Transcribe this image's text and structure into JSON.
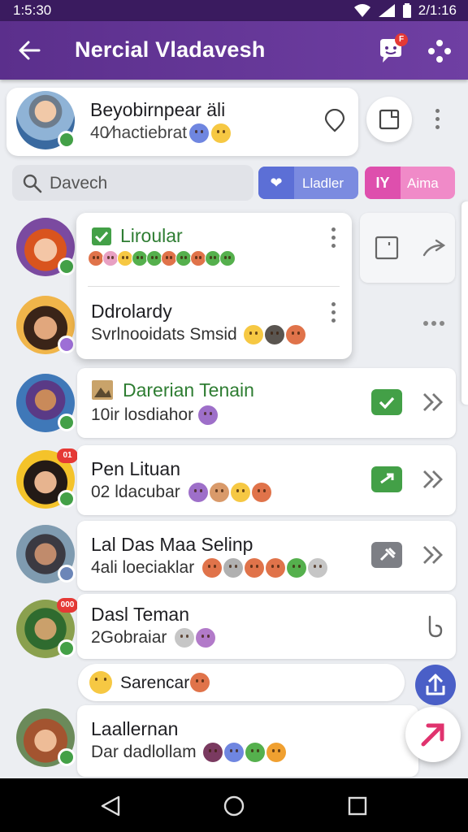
{
  "status_bar": {
    "time": "1:5:30",
    "clock_right": "2/1:16"
  },
  "app_bar": {
    "title": "Nercial Vladavesh",
    "badge": "F"
  },
  "profile": {
    "name": "Beyobirnpear äli",
    "subtitle": "40⁄hactiebrat"
  },
  "search": {
    "placeholder": "Davech"
  },
  "filters": [
    {
      "icon": "❤",
      "label": "Lladler"
    },
    {
      "icon": "IY",
      "label": "Aima"
    }
  ],
  "popup": {
    "item1_name": "Liroular",
    "item2_name": "Ddrolardy",
    "item2_sub": "Svrlnooidats Smsid"
  },
  "chats": [
    {
      "name": "Darerian Tenain",
      "subtitle": "10ir losdiahor"
    },
    {
      "name": "Pen Lituan",
      "subtitle": "02 ldacubar"
    },
    {
      "name": "Lal Das Maa Selinp",
      "subtitle": "4ali loeciaklar"
    },
    {
      "name": "Dasl Teman",
      "subtitle": "2Gobraiar"
    },
    {
      "name": "Laallernan",
      "subtitle": "Dar dadlollam"
    }
  ],
  "badges": {
    "pen_lituan": "01",
    "dasl_teman": "000"
  },
  "sarencar": {
    "label": "Sarencar"
  },
  "colors": {
    "status_bar": "#3a1b5f",
    "app_bar": "#5b2f8c",
    "accent_green": "#43a047",
    "accent_blue": "#4a5fc7",
    "accent_pink": "#de4fad",
    "fab_icon": "#e0336e"
  },
  "icons": {
    "back": "arrow-left-icon",
    "chat": "chat-bubble-icon",
    "more": "dots-cluster-icon",
    "compose": "square-icon",
    "search": "search-icon",
    "check": "check-icon",
    "chevron": "double-chevron-icon",
    "nav": [
      "triangle-back-icon",
      "circle-home-icon",
      "square-recents-icon"
    ]
  }
}
